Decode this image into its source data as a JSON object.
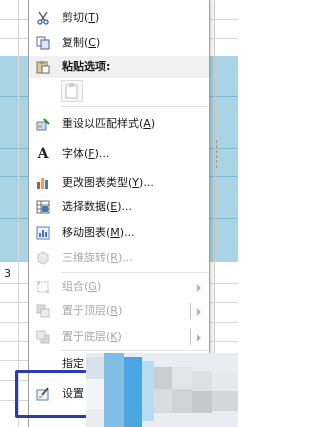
{
  "sheet": {
    "cell_value": "3"
  },
  "menu": {
    "items": [
      {
        "label": "剪切",
        "key": "T",
        "icon": "scissors-icon",
        "enabled": true
      },
      {
        "label": "复制",
        "key": "C",
        "icon": "copy-icon",
        "enabled": true
      },
      {
        "label": "粘贴选项:",
        "key": "",
        "icon": "paste-icon",
        "enabled": true
      },
      {
        "label": "重设以匹配样式",
        "key": "A",
        "icon": "reset-style-icon",
        "enabled": true
      },
      {
        "label": "字体",
        "key": "F",
        "suffix": "...",
        "icon": "font-icon",
        "enabled": true
      },
      {
        "label": "更改图表类型",
        "key": "Y",
        "suffix": "...",
        "icon": "chart-type-icon",
        "enabled": true
      },
      {
        "label": "选择数据",
        "key": "E",
        "suffix": "...",
        "icon": "select-data-icon",
        "enabled": true
      },
      {
        "label": "移动图表",
        "key": "M",
        "suffix": "...",
        "icon": "move-chart-icon",
        "enabled": true
      },
      {
        "label": "三维旋转",
        "key": "R",
        "suffix": "...",
        "icon": "3d-rotate-icon",
        "enabled": false
      },
      {
        "label": "组合",
        "key": "G",
        "icon": "group-icon",
        "enabled": false
      },
      {
        "label": "置于顶层",
        "key": "R",
        "icon": "bring-front-icon",
        "enabled": false
      },
      {
        "label": "置于底层",
        "key": "K",
        "icon": "send-back-icon",
        "enabled": false
      },
      {
        "label": "指定",
        "key": "",
        "icon": "",
        "enabled": true
      },
      {
        "label": "设置",
        "key": "",
        "icon": "format-icon",
        "enabled": true
      }
    ]
  },
  "colors": {
    "chart_fill": "#a8d4e4",
    "highlight": "#2b3bb0",
    "disabled_text": "#a8a8a8"
  }
}
